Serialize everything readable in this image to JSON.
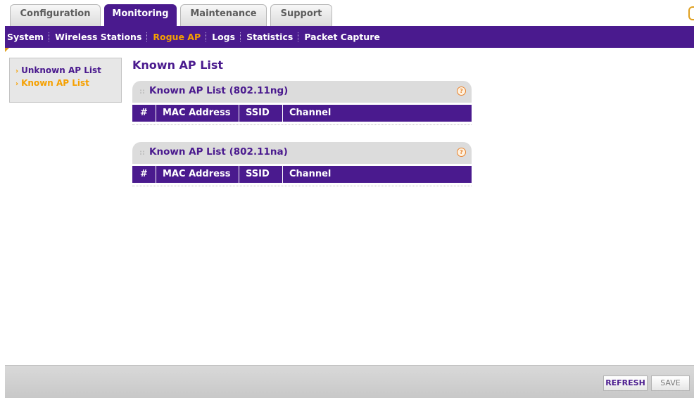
{
  "tabs": [
    {
      "label": "Configuration",
      "active": false
    },
    {
      "label": "Monitoring",
      "active": true
    },
    {
      "label": "Maintenance",
      "active": false
    },
    {
      "label": "Support",
      "active": false
    }
  ],
  "subnav": [
    "System",
    "Wireless Stations",
    "Rogue AP",
    "Logs",
    "Statistics",
    "Packet Capture"
  ],
  "subnav_active": "Rogue AP",
  "leftmenu": [
    "Unknown AP List",
    "Known AP List"
  ],
  "leftmenu_active": "Known AP List",
  "page_title": "Known AP List",
  "sections": [
    {
      "title": "Known AP List (802.11ng)",
      "columns": [
        "#",
        "MAC Address",
        "SSID",
        "Channel"
      ]
    },
    {
      "title": "Known AP List (802.11na)",
      "columns": [
        "#",
        "MAC Address",
        "SSID",
        "Channel"
      ]
    }
  ],
  "help_icon_glyph": "?",
  "buttons": {
    "refresh": "REFRESH",
    "save": "SAVE"
  },
  "colors": {
    "brand_purple": "#4a1a8e",
    "accent_orange": "#f5a000"
  }
}
